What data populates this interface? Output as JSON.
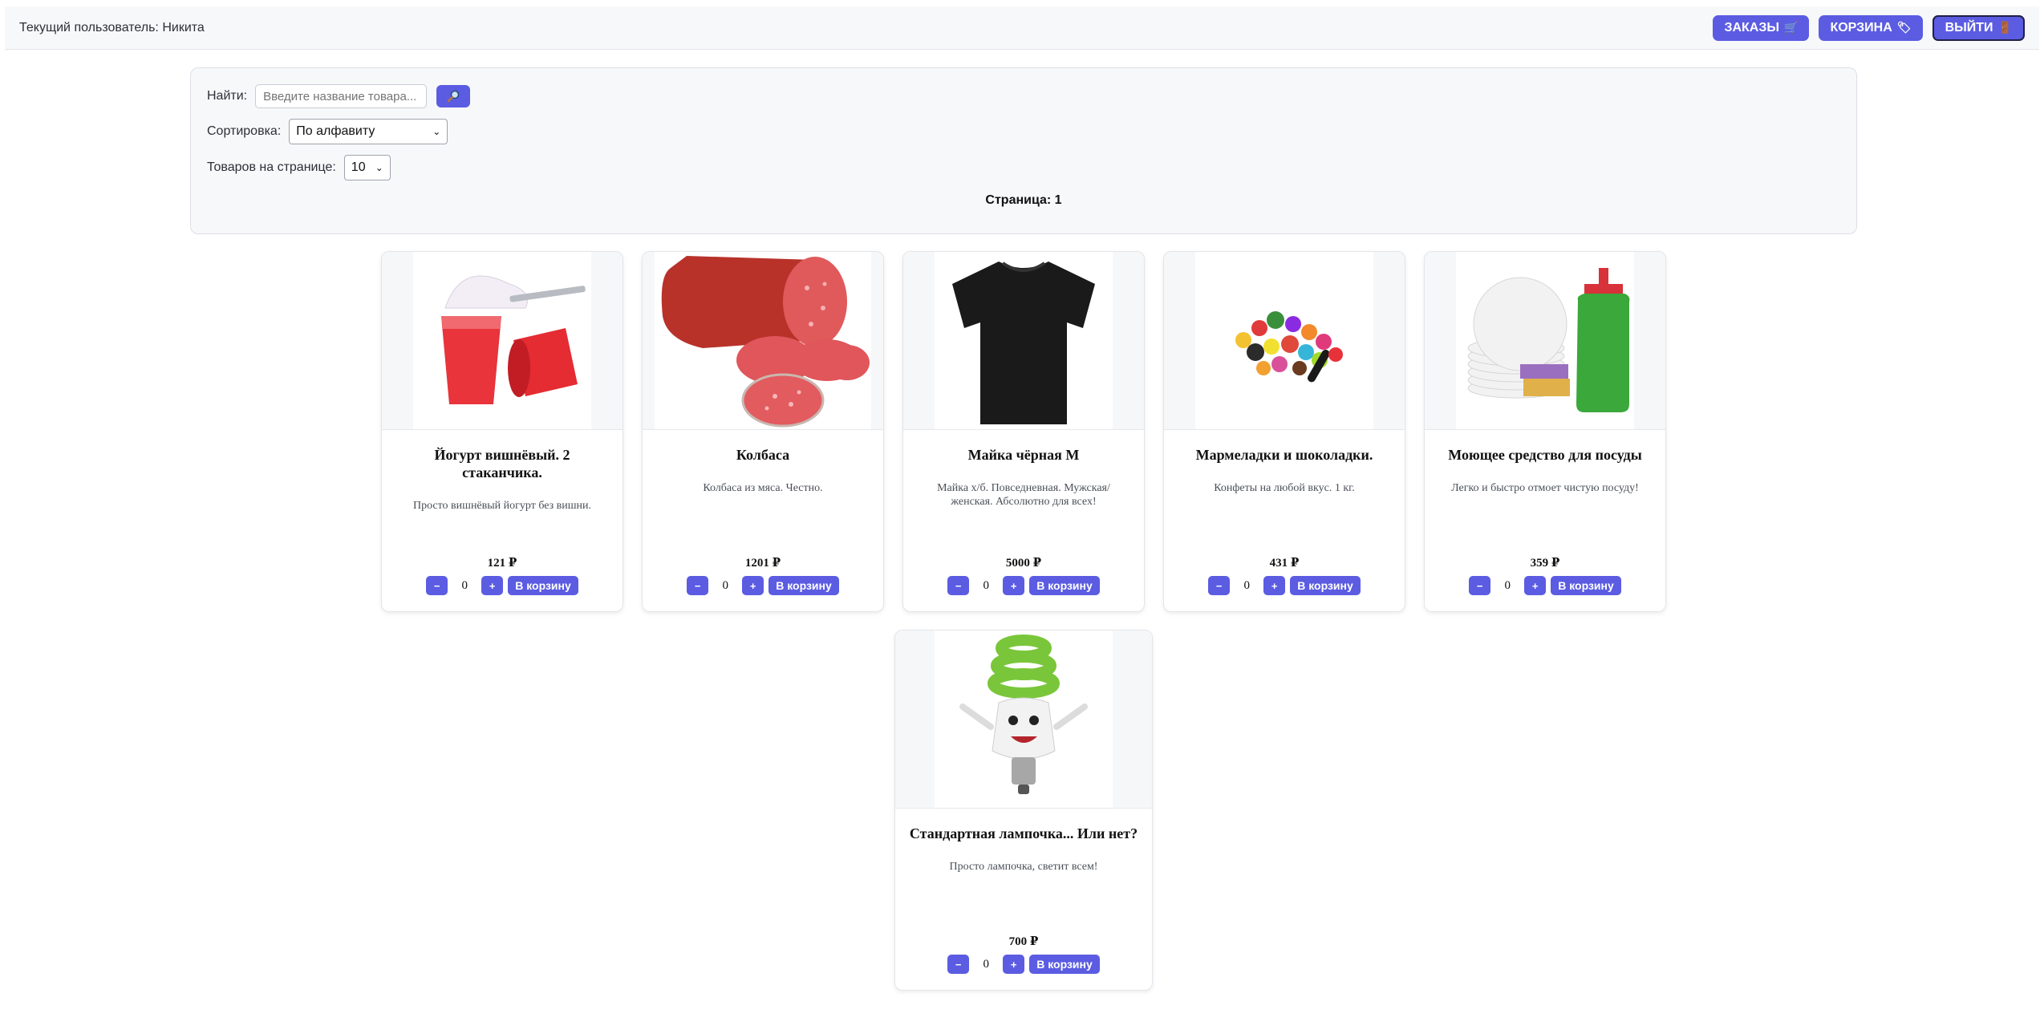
{
  "header": {
    "current_user": "Текущий пользователь: Никита",
    "orders_label": "ЗАКАЗЫ",
    "cart_label": "КОРЗИНА",
    "logout_label": "ВЫЙТИ",
    "orders_icon": "cart-icon",
    "cart_icon": "tag-icon",
    "logout_icon": "door-icon"
  },
  "filters": {
    "search_label": "Найти:",
    "search_placeholder": "Введите название товара...",
    "search_icon": "magnifier-icon",
    "sort_label": "Сортировка:",
    "sort_value": "По алфавиту",
    "per_page_label": "Товаров на странице:",
    "per_page_value": "10",
    "page_label": "Страница: 1"
  },
  "cart_button_label": "В корзину",
  "minus_label": "−",
  "plus_label": "+",
  "products": [
    {
      "name": "Йогурт вишнёвый. 2 стаканчика.",
      "desc": "Просто вишнёвый йогурт без вишни.",
      "price": "121 ₽",
      "qty": "0",
      "image": "yogurt-image"
    },
    {
      "name": "Колбаса",
      "desc": "Колбаса из мяса. Честно.",
      "price": "1201 ₽",
      "qty": "0",
      "image": "sausage-image"
    },
    {
      "name": "Майка чёрная M",
      "desc": "Майка х/б. Повседневная. Мужская/женская. Абсолютно для всех!",
      "price": "5000 ₽",
      "qty": "0",
      "image": "tshirt-image"
    },
    {
      "name": "Мармеладки и шоколадки.",
      "desc": "Конфеты на любой вкус. 1 кг.",
      "price": "431 ₽",
      "qty": "0",
      "image": "candies-image"
    },
    {
      "name": "Моющее средство для посуды",
      "desc": "Легко и быстро отмоет чистую посуду!",
      "price": "359 ₽",
      "qty": "0",
      "image": "dish-soap-image"
    },
    {
      "name": "Стандартная лампочка... Или нет?",
      "desc": "Просто лампочка, светит всем!",
      "price": "700 ₽",
      "qty": "0",
      "image": "lightbulb-image"
    }
  ],
  "colors": {
    "accent": "#5b5ce2",
    "panel": "#f7f8fa"
  }
}
